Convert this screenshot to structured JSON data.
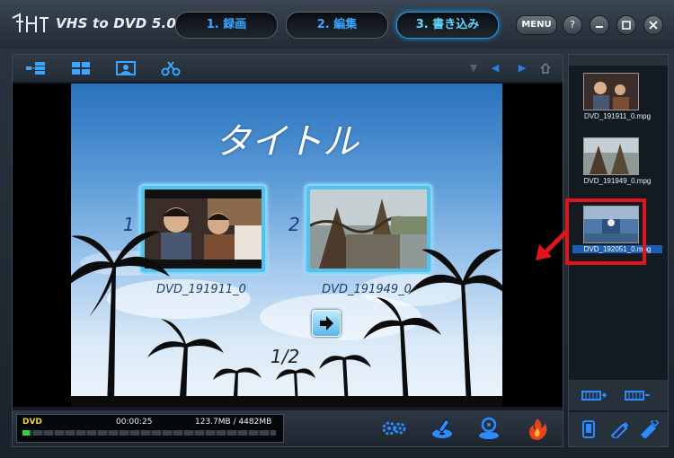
{
  "app": {
    "title": "VHS to DVD 5.0",
    "steps": [
      {
        "label": "1. 録画",
        "active": false
      },
      {
        "label": "2. 編集",
        "active": false
      },
      {
        "label": "3. 書き込み",
        "active": true
      }
    ],
    "menu_label": "MENU",
    "help_label": "?"
  },
  "toolbar": {
    "tools": [
      "layout-tree-icon",
      "layout-grid-icon",
      "image-icon",
      "scissors-icon"
    ],
    "nav": [
      "down-triangle-icon",
      "left-arrow-icon",
      "right-arrow-icon",
      "home-icon"
    ]
  },
  "menu_preview": {
    "title": "タイトル",
    "items": [
      {
        "number": "1",
        "caption": "DVD_191911_0"
      },
      {
        "number": "2",
        "caption": "DVD_191949_0"
      }
    ],
    "page": "1/2"
  },
  "status": {
    "disc_type": "DVD",
    "duration": "00:00:25",
    "size": "123.7MB / 4482MB",
    "capacity_fraction": 0.028
  },
  "files": [
    {
      "name": "DVD_191911_0.mpg",
      "selected": false
    },
    {
      "name": "DVD_191949_0.mpg",
      "selected": false
    },
    {
      "name": "DVD_192051_0.mpg",
      "selected": true
    }
  ],
  "colors": {
    "accent": "#3aa6ff",
    "highlight": "#e0151b",
    "selection": "#1b5fb3"
  }
}
